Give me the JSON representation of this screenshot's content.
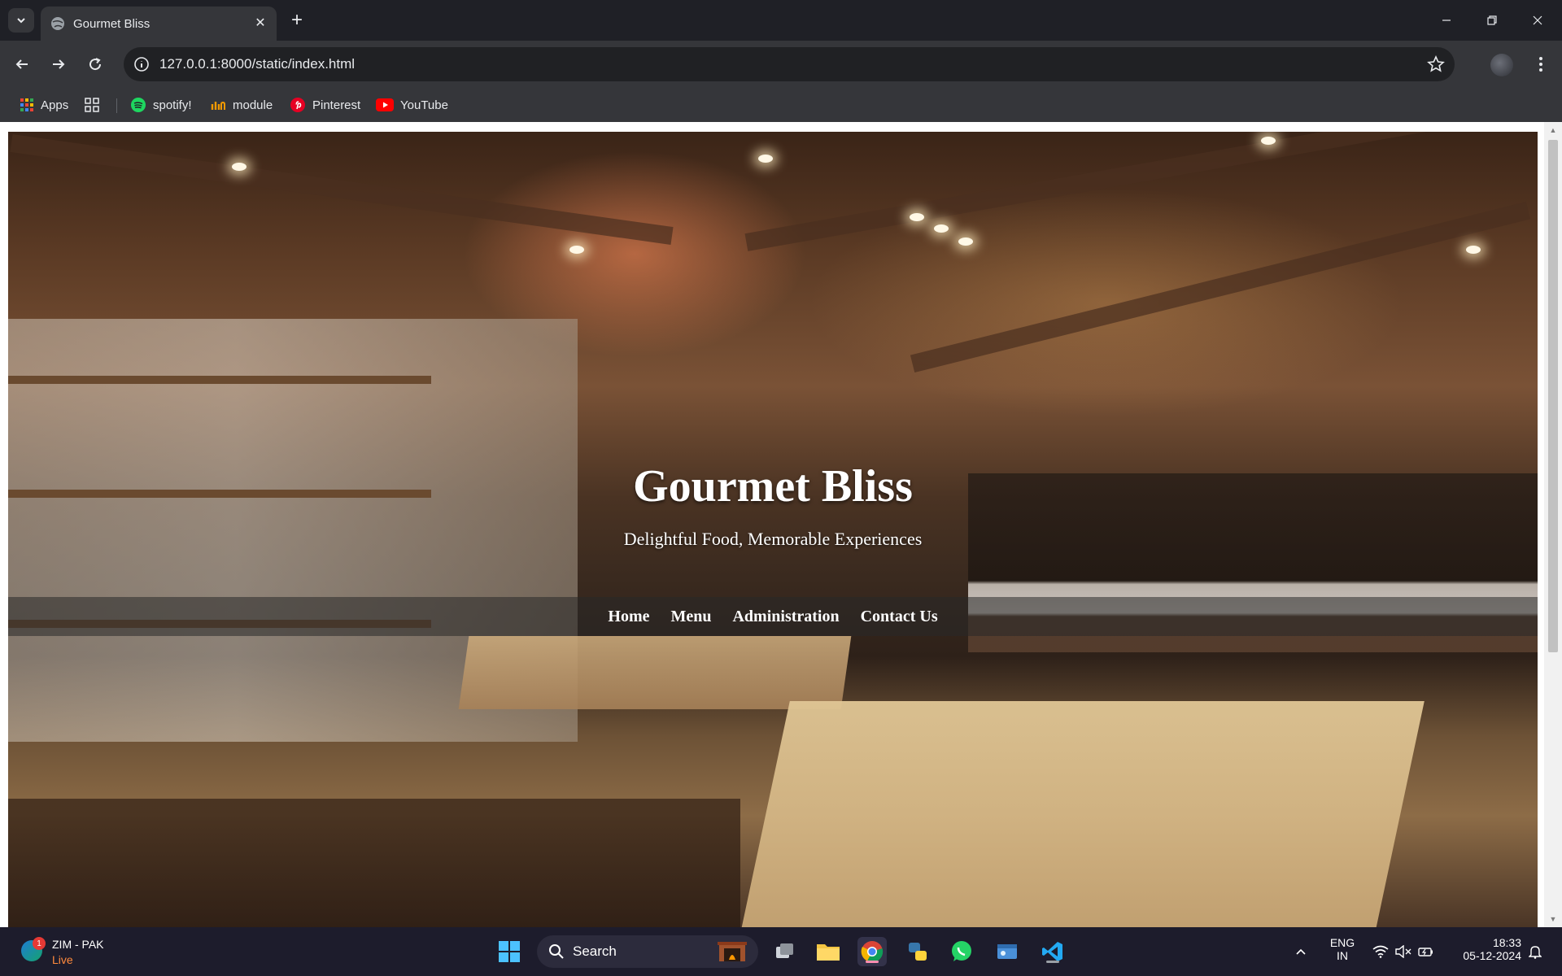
{
  "browser": {
    "tab_title": "Gourmet Bliss",
    "url": "127.0.0.1:8000/static/index.html",
    "bookmarks": [
      {
        "label": "Apps",
        "icon": "apps-grid-icon"
      },
      {
        "label": "",
        "icon": "tab-groups-icon"
      },
      {
        "label": "spotify!",
        "icon": "spotify-icon"
      },
      {
        "label": "module",
        "icon": "module-icon"
      },
      {
        "label": "Pinterest",
        "icon": "pinterest-icon"
      },
      {
        "label": "YouTube",
        "icon": "youtube-icon"
      }
    ]
  },
  "page": {
    "title": "Gourmet Bliss",
    "subtitle": "Delightful Food, Memorable Experiences",
    "nav": [
      {
        "label": "Home"
      },
      {
        "label": "Menu"
      },
      {
        "label": "Administration"
      },
      {
        "label": "Contact Us"
      }
    ]
  },
  "taskbar": {
    "widget_title": "ZIM - PAK",
    "widget_subtitle": "Live",
    "widget_badge": "1",
    "search_label": "Search",
    "language_top": "ENG",
    "language_bottom": "IN",
    "time": "18:33",
    "date": "05-12-2024",
    "pinned": [
      "windows-start-icon",
      "search-icon",
      "task-view-icon",
      "file-explorer-icon",
      "chrome-icon",
      "python-icon",
      "whatsapp-icon",
      "media-app-icon",
      "vscode-icon"
    ]
  },
  "colors": {
    "chrome_dark": "#1f2026",
    "chrome_toolbar": "#35363a",
    "taskbar": "#1d1c2c",
    "text_light": "#e8eaed",
    "live_orange": "#ff8a3d"
  }
}
